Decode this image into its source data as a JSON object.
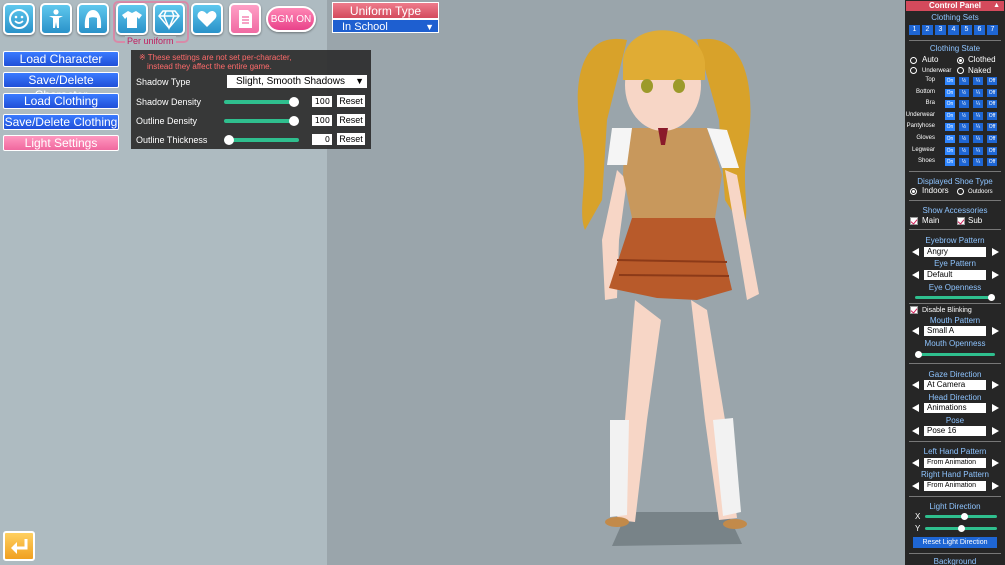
{
  "toolbar": {
    "icons": [
      "face-icon",
      "body-icon",
      "hair-icon",
      "shirt-icon",
      "diamond-icon",
      "heart-icon",
      "document-icon"
    ],
    "per_uniform_label": "Per uniform",
    "bgm_label": "BGM ON"
  },
  "uniform_type": {
    "title": "Uniform Type",
    "value": "In School"
  },
  "left_menu": {
    "load_character": "Load Character",
    "save_delete_character": "Save/Delete Character",
    "load_clothing": "Load Clothing",
    "save_delete_clothing": "Save/Delete Clothing",
    "light_settings": "Light Settings"
  },
  "light_panel": {
    "note_line1": "※ These settings are not set per-character,",
    "note_line2": "instead they affect the entire game.",
    "shadow_type_label": "Shadow Type",
    "shadow_type_value": "Slight, Smooth Shadows",
    "shadow_density_label": "Shadow Density",
    "shadow_density_value": "100",
    "shadow_density_level": 1.0,
    "outline_density_label": "Outline Density",
    "outline_density_value": "100",
    "outline_density_level": 1.0,
    "outline_thickness_label": "Outline Thickness",
    "outline_thickness_value": "0",
    "outline_thickness_level": 0.0,
    "reset_label": "Reset"
  },
  "control_panel": {
    "title": "Control Panel",
    "clothing_sets": {
      "label": "Clothing Sets",
      "items": [
        "1",
        "2",
        "3",
        "4",
        "5",
        "6",
        "7"
      ]
    },
    "clothing_state": {
      "label": "Clothing State",
      "auto": "Auto",
      "clothed": "Clothed",
      "underwear": "Underwear",
      "naked": "Naked",
      "rows": [
        "Top",
        "Bottom",
        "Bra",
        "Underwear",
        "Pantyhose",
        "Gloves",
        "Legwear",
        "Shoes"
      ],
      "states": [
        "On",
        "½",
        "¼",
        "Off"
      ]
    },
    "shoe_type": {
      "label": "Displayed Shoe Type",
      "indoors": "Indoors",
      "outdoors": "Outdoors"
    },
    "accessories": {
      "label": "Show Accessories",
      "main": "Main",
      "sub": "Sub"
    },
    "eyebrow": {
      "label": "Eyebrow Pattern",
      "value": "Angry"
    },
    "eye": {
      "label": "Eye Pattern",
      "value": "Default"
    },
    "eye_openness": {
      "label": "Eye Openness",
      "level": 1.0
    },
    "disable_blinking": "Disable Blinking",
    "mouth": {
      "label": "Mouth Pattern",
      "value": "Small A"
    },
    "mouth_openness": {
      "label": "Mouth Openness",
      "level": 0.0
    },
    "gaze": {
      "label": "Gaze Direction",
      "value": "At Camera"
    },
    "head": {
      "label": "Head Direction",
      "value": "Animations"
    },
    "pose": {
      "label": "Pose",
      "value": "Pose 16"
    },
    "left_hand": {
      "label": "Left Hand Pattern",
      "value": "From Animation"
    },
    "right_hand": {
      "label": "Right Hand Pattern",
      "value": "From Animation"
    },
    "light_direction": {
      "label": "Light Direction",
      "x_label": "X",
      "y_label": "Y",
      "x_level": 0.55,
      "y_level": 0.5,
      "reset": "Reset Light Direction"
    },
    "background": "Background"
  },
  "colors": {
    "accent_blue": "#1e66d4",
    "accent_pink": "#f06aa2",
    "slider": "#2fbf8e"
  }
}
